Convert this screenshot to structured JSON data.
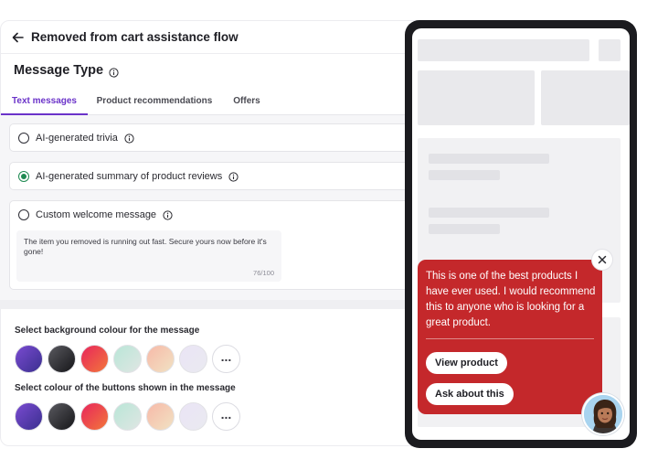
{
  "flow": {
    "title": "Removed from cart assistance flow"
  },
  "message_type": {
    "heading": "Message Type",
    "tabs": [
      {
        "label": "Text messages",
        "active": true
      },
      {
        "label": "Product recommendations",
        "active": false
      },
      {
        "label": "Offers",
        "active": false
      }
    ],
    "options": [
      {
        "label": "AI-generated trivia",
        "selected": false
      },
      {
        "label": "AI-generated summary of product reviews",
        "selected": true
      },
      {
        "label": "Custom welcome message",
        "selected": false
      }
    ],
    "custom_message": {
      "value": "The item you removed is running out fast. Secure yours now before it's gone!",
      "counter": "76/100"
    }
  },
  "background_colour": {
    "label": "Select background colour for the message",
    "swatch_names": [
      "purple-gradient",
      "black-gradient",
      "red-orange-gradient",
      "mint-gradient",
      "peach-gradient",
      "lavender-gradient"
    ],
    "more_icon": "more-icon"
  },
  "button_colour": {
    "label": "Select colour of the buttons shown in the message",
    "swatch_names": [
      "purple-gradient",
      "black-gradient",
      "red-orange-gradient",
      "mint-gradient",
      "peach-gradient",
      "lavender-gradient"
    ],
    "more_icon": "more-icon"
  },
  "preview": {
    "message": "This is one of the best products I have ever used. I would recommend this to anyone who is looking for a great product.",
    "buttons": [
      "View product",
      "Ask about this"
    ],
    "popup_color": "#c4282b"
  },
  "colors": {
    "accent": "#6b33c9",
    "selected_radio": "#1f8a52"
  }
}
